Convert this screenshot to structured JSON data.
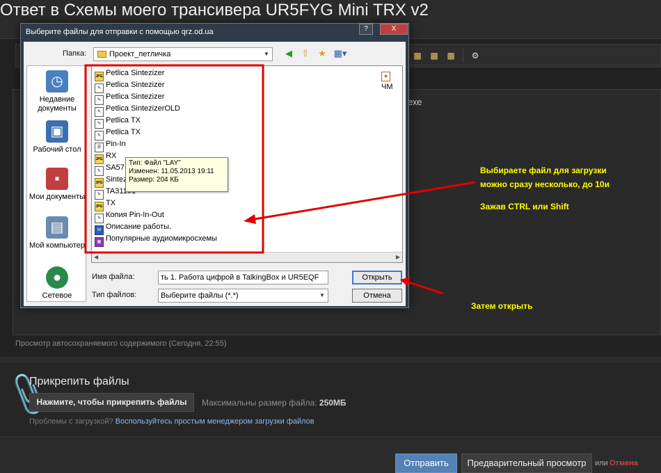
{
  "page": {
    "title": "Ответ в Схемы моего трансивера UR5FYG Mini TRX v2",
    "editor_text_fragment": "ехе",
    "autosave_text": "Просмотр автосохраняемого содержимого (Сегодня, 22:55)"
  },
  "attachments": {
    "title": "Прикрепить файлы",
    "button_label": "Нажмите, чтобы прикрепить файлы",
    "max_size_label": "Максимальны размер файла:",
    "max_size_value": "250МБ",
    "problem_text": "Проблемы с загрузкой?",
    "problem_link": "Воспользуйтесь простым менеджером загрузки файлов"
  },
  "footer": {
    "submit_label": "Отправить",
    "preview_label": "Предварительный просмотр",
    "or_text": "или",
    "cancel_label": "Отмена"
  },
  "annotations": {
    "line1": "Выбираете файл для загрузки",
    "line2": "можно сразу несколько, до 10и",
    "line3": "Зажав CTRL или Shift",
    "line4": "Затем открыть",
    "color": "#ffff00",
    "arrow_color": "#e00000"
  },
  "dialog": {
    "title": "Выберите файлы для отправки с помощью qrz.od.ua",
    "help_btn": "?",
    "close_btn": "X",
    "folder_label": "Папка:",
    "folder_value": "Проект_петличка",
    "places": [
      {
        "label": "Недавние документы",
        "icon": "recent-docs-icon"
      },
      {
        "label": "Рабочий стол",
        "icon": "desktop-icon"
      },
      {
        "label": "Мои документы",
        "icon": "my-documents-icon"
      },
      {
        "label": "Мой компьютер",
        "icon": "my-computer-icon"
      },
      {
        "label": "Сетевое",
        "icon": "network-icon"
      }
    ],
    "files": [
      {
        "name": "Petlica Sintezizer",
        "icon": "jpg"
      },
      {
        "name": "Petlica Sintezizer",
        "icon": "doc"
      },
      {
        "name": "Petlica Sintezizer",
        "icon": "doc"
      },
      {
        "name": "Petlica SintezizerOLD",
        "icon": "doc"
      },
      {
        "name": "Petlica TX",
        "icon": "doc"
      },
      {
        "name": "Petlica TX",
        "icon": "doc"
      },
      {
        "name": "Pin-In",
        "icon": "doc"
      },
      {
        "name": "RX",
        "icon": "jpg"
      },
      {
        "name": "SA57",
        "icon": "doc"
      },
      {
        "name": "Sintezizer",
        "icon": "jpg"
      },
      {
        "name": "TA31101",
        "icon": "doc"
      },
      {
        "name": "TX",
        "icon": "jpg"
      },
      {
        "name": "Копия Pin-In-Out",
        "icon": "doc"
      },
      {
        "name": "Описание работы.",
        "icon": "word"
      },
      {
        "name": "Популярные аудиомикросхемы",
        "icon": "rar"
      }
    ],
    "right_file": "ЧМ",
    "tooltip": {
      "type": "Тип: Файл \"LAY\"",
      "modified": "Изменен: 11.05.2013 19:11",
      "size": "Размер: 204 КБ"
    },
    "filename_label": "Имя файла:",
    "filename_value": "ть 1. Работа цифрой в TalkingBox и UR5EQF",
    "filetype_label": "Тип файлов:",
    "filetype_value": "Выберите файлы (*.*)",
    "open_btn": "Открыть",
    "cancel_btn": "Отмена"
  }
}
